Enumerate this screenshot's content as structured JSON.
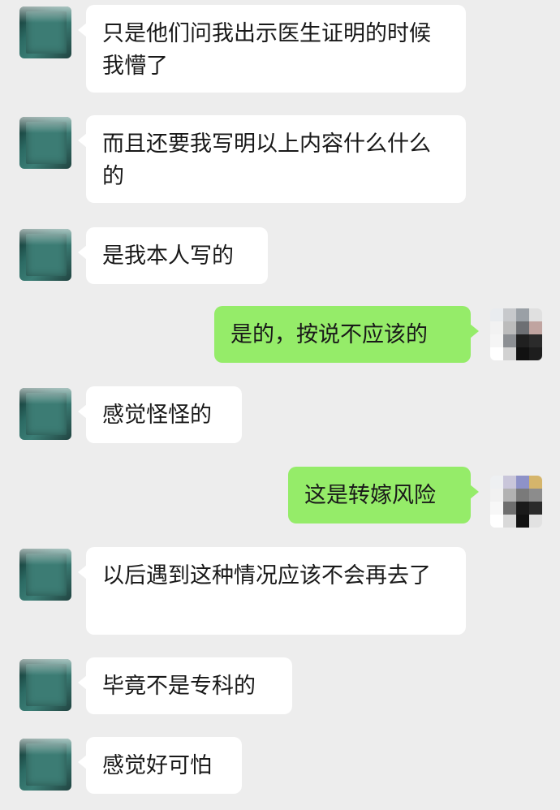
{
  "chat": {
    "messages": [
      {
        "side": "left",
        "text": "只是他们问我出示医生证明的时候我懵了"
      },
      {
        "side": "left",
        "text": "而且还要我写明以上内容什么什么的"
      },
      {
        "side": "left",
        "text": "是我本人写的"
      },
      {
        "side": "right",
        "text": "是的，按说不应该的"
      },
      {
        "side": "left",
        "text": "感觉怪怪的"
      },
      {
        "side": "right",
        "text": "这是转嫁风险"
      },
      {
        "side": "left",
        "text": "以后遇到这种情况应该不会再去了"
      },
      {
        "side": "left",
        "text": "毕竟不是专科的"
      },
      {
        "side": "left",
        "text": "感觉好可怕"
      }
    ]
  },
  "colors": {
    "background": "#ededed",
    "incoming_bubble": "#ffffff",
    "outgoing_bubble": "#95ec69",
    "text": "#191919"
  },
  "icons": {
    "contact_avatar": "contact-avatar-icon",
    "user_avatar": "user-avatar-icon"
  }
}
